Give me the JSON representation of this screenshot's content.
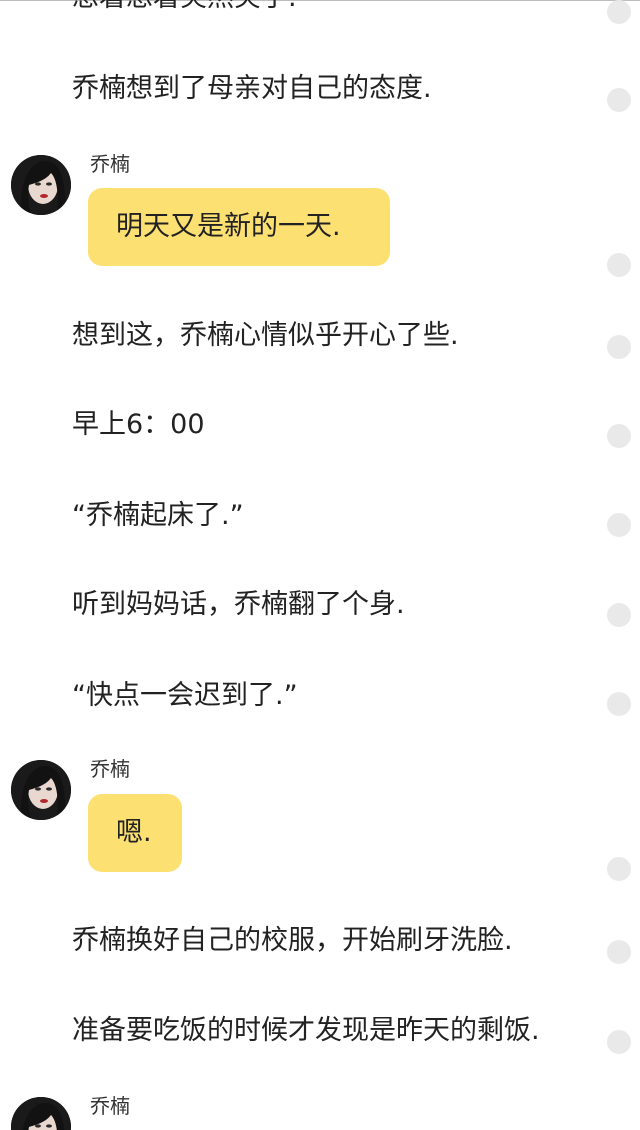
{
  "feed": {
    "narration": [
      "想着想着突然笑了.",
      "乔楠想到了母亲对自己的态度.",
      "想到这，乔楠心情似乎开心了些.",
      "早上6：00",
      "“乔楠起床了.”",
      "听到妈妈话，乔楠翻了个身.",
      "“快点一会迟到了.”",
      "乔楠换好自己的校服，开始刷牙洗脸.",
      "准备要吃饭的时候才发现是昨天的剩饭."
    ],
    "messages": [
      {
        "speaker": "乔楠",
        "text": "明天又是新的一天."
      },
      {
        "speaker": "乔楠",
        "text": "嗯."
      },
      {
        "speaker": "乔楠",
        "text": ""
      }
    ]
  },
  "colors": {
    "bubble": "#fde072",
    "text": "#222222",
    "dot": "#e9e9e9"
  },
  "icons": {
    "avatar": "character-avatar-icon",
    "dot": "comment-dot-icon"
  }
}
